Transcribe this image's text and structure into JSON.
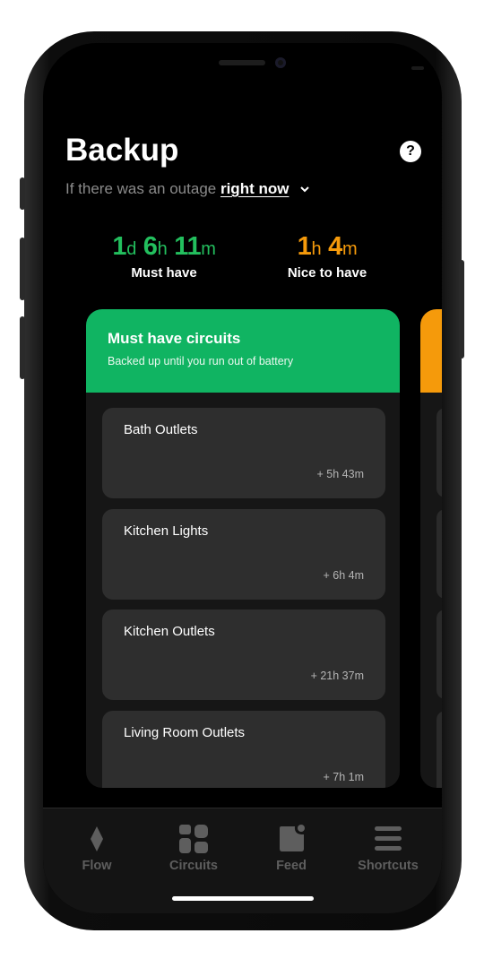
{
  "header": {
    "title": "Backup",
    "help_icon": "?"
  },
  "outage": {
    "prefix": "If there was an outage",
    "selected": "right now"
  },
  "stats": {
    "must": {
      "d": "1",
      "d_unit": "d",
      "h": "6",
      "h_unit": "h",
      "m": "11",
      "m_unit": "m",
      "label": "Must have"
    },
    "nice": {
      "h": "1",
      "h_unit": "h",
      "m": "4",
      "m_unit": "m",
      "label": "Nice to have"
    }
  },
  "card": {
    "title": "Must have circuits",
    "subtitle": "Backed up until you run out of battery",
    "accent": "#10b462",
    "circuits": [
      {
        "name": "Bath Outlets",
        "time": "+ 5h 43m"
      },
      {
        "name": "Kitchen Lights",
        "time": "+ 6h 4m"
      },
      {
        "name": "Kitchen Outlets",
        "time": "+ 21h 37m"
      },
      {
        "name": "Living Room Outlets",
        "time": "+ 7h 1m"
      }
    ]
  },
  "peek_card": {
    "accent": "#f59a0b"
  },
  "nav": {
    "items": [
      {
        "label": "Flow",
        "icon": "flow-icon"
      },
      {
        "label": "Circuits",
        "icon": "circuits-icon"
      },
      {
        "label": "Feed",
        "icon": "feed-icon"
      },
      {
        "label": "Shortcuts",
        "icon": "shortcuts-icon"
      }
    ]
  },
  "colors": {
    "must_green": "#23bf5e",
    "nice_orange": "#f59a0b",
    "background": "#000000"
  }
}
